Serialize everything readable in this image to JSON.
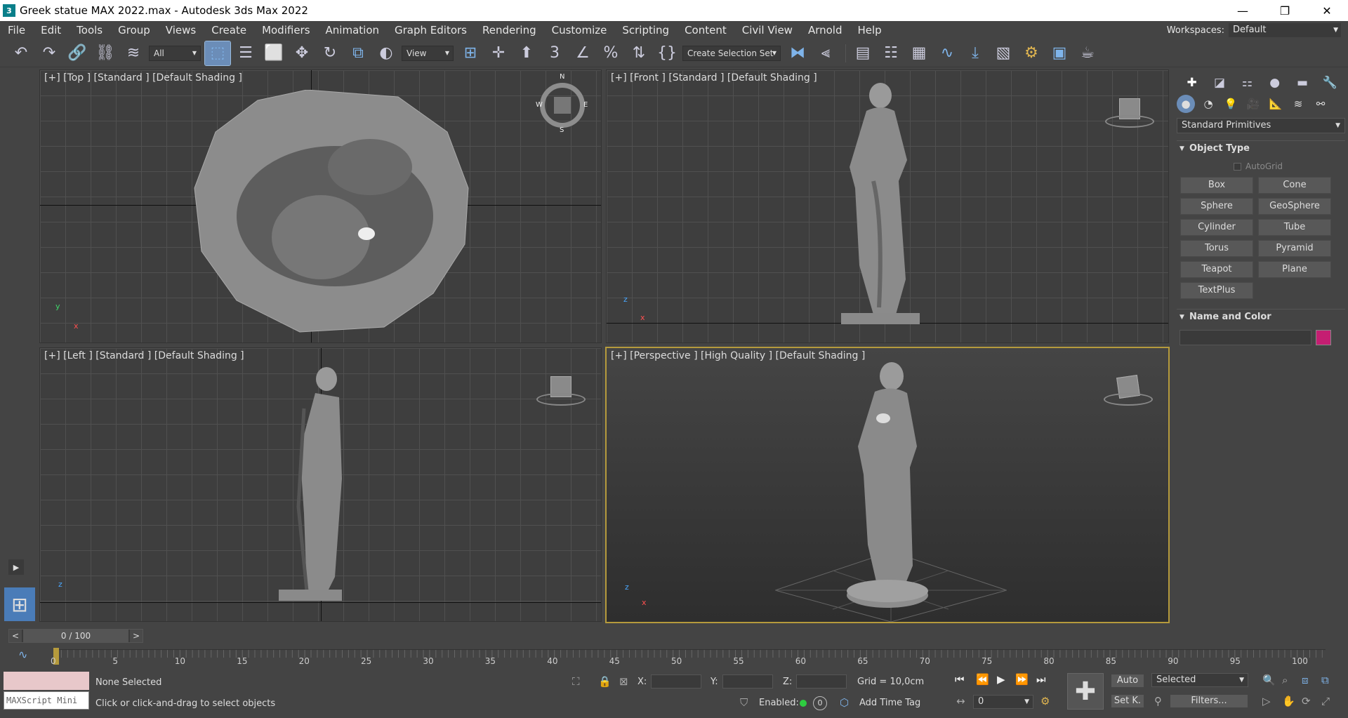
{
  "window": {
    "title": "Greek statue MAX 2022.max - Autodesk 3ds Max 2022",
    "app_icon": "3"
  },
  "menu": [
    "File",
    "Edit",
    "Tools",
    "Group",
    "Views",
    "Create",
    "Modifiers",
    "Animation",
    "Graph Editors",
    "Rendering",
    "Customize",
    "Scripting",
    "Content",
    "Civil View",
    "Arnold",
    "Help"
  ],
  "workspace": {
    "label": "Workspaces:",
    "value": "Default"
  },
  "toolbar": {
    "filter": "All",
    "refcoord": "View",
    "selection_set": "Create Selection Set"
  },
  "viewports": {
    "top": {
      "label": "[+] [Top ] [Standard ] [Default Shading ]"
    },
    "front": {
      "label": "[+] [Front ] [Standard ] [Default Shading ]"
    },
    "left": {
      "label": "[+] [Left ] [Standard ] [Default Shading ]"
    },
    "perspective": {
      "label": "[+] [Perspective ] [High Quality ] [Default Shading ]"
    },
    "compass": {
      "n": "N",
      "s": "S",
      "e": "E",
      "w": "W"
    },
    "axes": {
      "x": "x",
      "y": "y",
      "z": "z"
    }
  },
  "command_panel": {
    "category": "Standard Primitives",
    "object_type": "Object Type",
    "autogrid": "AutoGrid",
    "buttons": [
      "Box",
      "Cone",
      "Sphere",
      "GeoSphere",
      "Cylinder",
      "Tube",
      "Torus",
      "Pyramid",
      "Teapot",
      "Plane",
      "TextPlus"
    ],
    "name_and_color": "Name and Color",
    "color": "#c51e72"
  },
  "timeline": {
    "frame": "0 / 100",
    "prev": "<",
    "next": ">",
    "ticks": [
      "0",
      "5",
      "10",
      "15",
      "20",
      "25",
      "30",
      "35",
      "40",
      "45",
      "50",
      "55",
      "60",
      "65",
      "70",
      "75",
      "80",
      "85",
      "90",
      "95",
      "100"
    ]
  },
  "status": {
    "maxscript": "MAXScript Mini",
    "selected": "None Selected",
    "prompt": "Click or click-and-drag to select objects",
    "x_label": "X:",
    "y_label": "Y:",
    "z_label": "Z:",
    "grid": "Grid = 10,0cm",
    "enabled": "Enabled:",
    "add_time_tag": "Add Time Tag",
    "auto": "Auto",
    "set_k": "Set K.",
    "key_filter": "Selected",
    "filters": "Filters...",
    "frame_field": "0",
    "zero_badge": "0"
  }
}
